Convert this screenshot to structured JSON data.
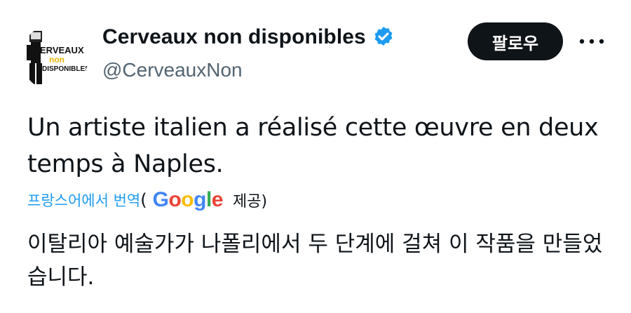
{
  "profile": {
    "display_name": "Cerveaux non disponibles",
    "handle": "@CerveauxNon",
    "avatar_logo_text": "CERVEAUX non DISPONIBLES",
    "verified": true,
    "verified_color": "#1d9bf0"
  },
  "actions": {
    "follow_label": "팔로우",
    "more_icon": "more-horizontal-icon"
  },
  "tweet": {
    "text": "Un artiste italien a réalisé cette œuvre en deux temps à Naples."
  },
  "translation": {
    "link_label": "프랑스어에서 번역",
    "open_paren": "(",
    "provider": "Google",
    "provider_suffix": "제공)",
    "text": "이탈리아 예술가가 나폴리에서 두 단계에 걸쳐 이 작품을 만들었습니다."
  },
  "colors": {
    "text": "#0f1419",
    "secondary": "#536471",
    "link": "#1d9bf0",
    "button_bg": "#0f1419"
  }
}
